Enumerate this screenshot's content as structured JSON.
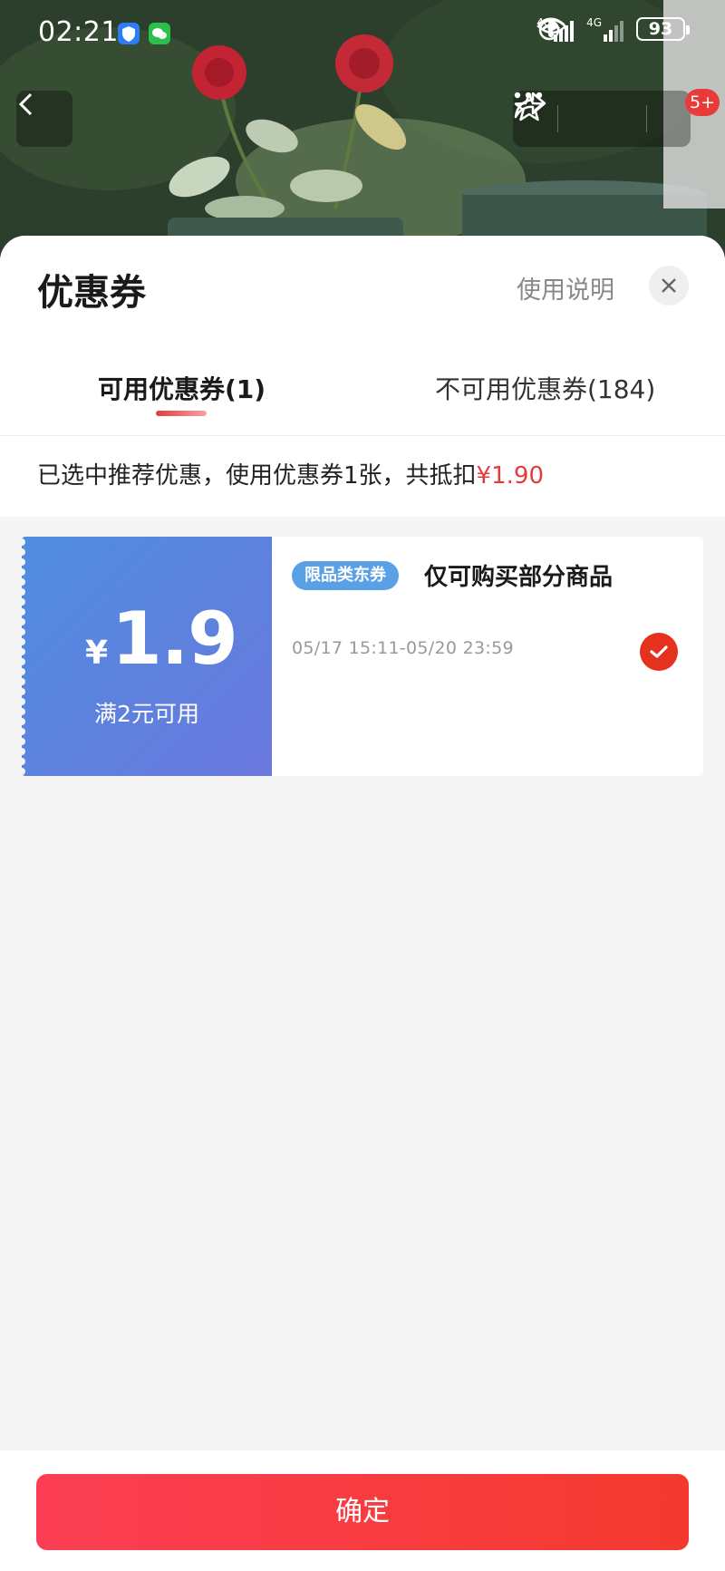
{
  "status_bar": {
    "time": "02:21",
    "battery": "93",
    "network_1": "4G",
    "network_2": "4G"
  },
  "nav": {
    "back_icon": "chevron-left-icon",
    "star_icon": "star-icon",
    "share_icon": "share-icon",
    "more_icon": "more-icon",
    "badge": "5+"
  },
  "sheet": {
    "title": "优惠券",
    "usage_link": "使用说明",
    "close_icon": "close-icon"
  },
  "tabs": [
    {
      "label": "可用优惠券(1)",
      "active": true
    },
    {
      "label": "不可用优惠券(184)",
      "active": false
    }
  ],
  "summary": {
    "text": "已选中推荐优惠，使用优惠券1张，共抵扣",
    "amount": "¥1.90"
  },
  "coupon": {
    "currency": "¥",
    "value": "1.9",
    "condition": "满2元可用",
    "tag": "限品类东券",
    "title": "仅可购买部分商品",
    "date": "05/17 15:11-05/20 23:59",
    "selected": true
  },
  "footer": {
    "confirm_label": "确定"
  },
  "colors": {
    "accent": "#e4321f",
    "coupon_blue": "#4f8de0",
    "tag_blue": "#5aa0e6",
    "confirm_red": "#fb3e54"
  }
}
